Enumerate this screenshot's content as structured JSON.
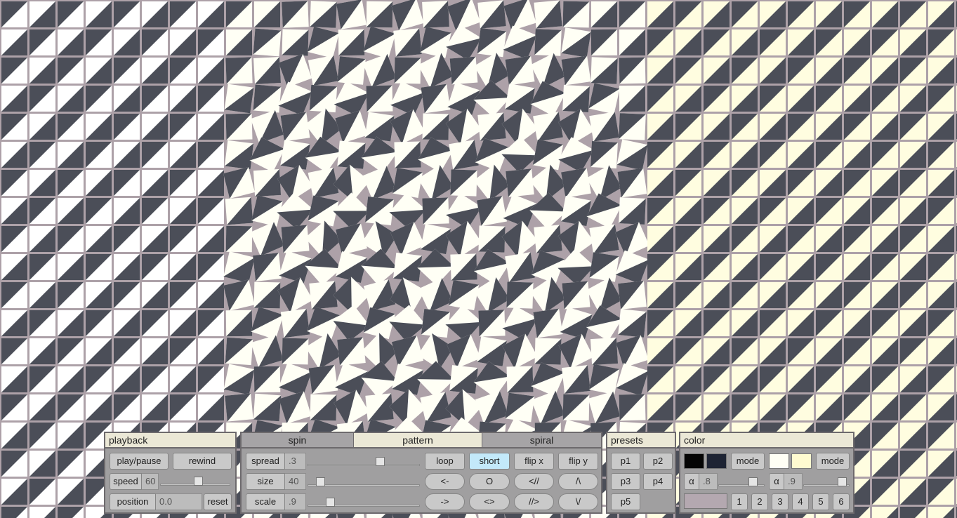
{
  "colors": {
    "panel": "#a09fa0",
    "title_bar": "#ebe8d6",
    "active_button": "#c3e9fa",
    "canvas_bg": "#ada1a8",
    "tile_dark": "#4b4e58",
    "tile_light_left": "#ffffff",
    "tile_light_mid": "#fffff5",
    "tile_light_right": "#fffde0"
  },
  "playback": {
    "title": "playback",
    "play_pause": "play/pause",
    "rewind": "rewind",
    "speed_label": "speed",
    "speed_value": "60",
    "speed_level": 0.55,
    "position_label": "position",
    "position_value": "0.0",
    "reset": "reset"
  },
  "pattern": {
    "tabs": [
      {
        "label": "spin",
        "active": false
      },
      {
        "label": "pattern",
        "active": true
      },
      {
        "label": "spiral",
        "active": false
      }
    ],
    "spread_label": "spread",
    "spread_value": ".3",
    "spread_level": 0.66,
    "size_label": "size",
    "size_value": "40",
    "size_level": 0.08,
    "scale_label": "scale",
    "scale_value": ".9",
    "scale_level": 0.18,
    "buttons": [
      "loop",
      "short",
      "flip x",
      "flip y",
      "<-",
      "O",
      "<//",
      "/\\",
      "->",
      "<>",
      "//>",
      "\\/"
    ],
    "active_button": "short"
  },
  "presets": {
    "title": "presets",
    "items": [
      "p1",
      "p2",
      "p3",
      "p4",
      "p5"
    ]
  },
  "color": {
    "title": "color",
    "swatches_a": [
      "#050505",
      "#1e2434"
    ],
    "swatches_b": [
      "#fffff5",
      "#fffbd0"
    ],
    "mode_label": "mode",
    "alpha_symbol": "α",
    "alpha_a_value": ".8",
    "alpha_a_level": 0.82,
    "alpha_b_value": ".9",
    "alpha_b_level": 0.92,
    "bg_swatch": "#b4a8b0",
    "numbers": [
      "1",
      "2",
      "3",
      "4",
      "5",
      "6"
    ]
  }
}
